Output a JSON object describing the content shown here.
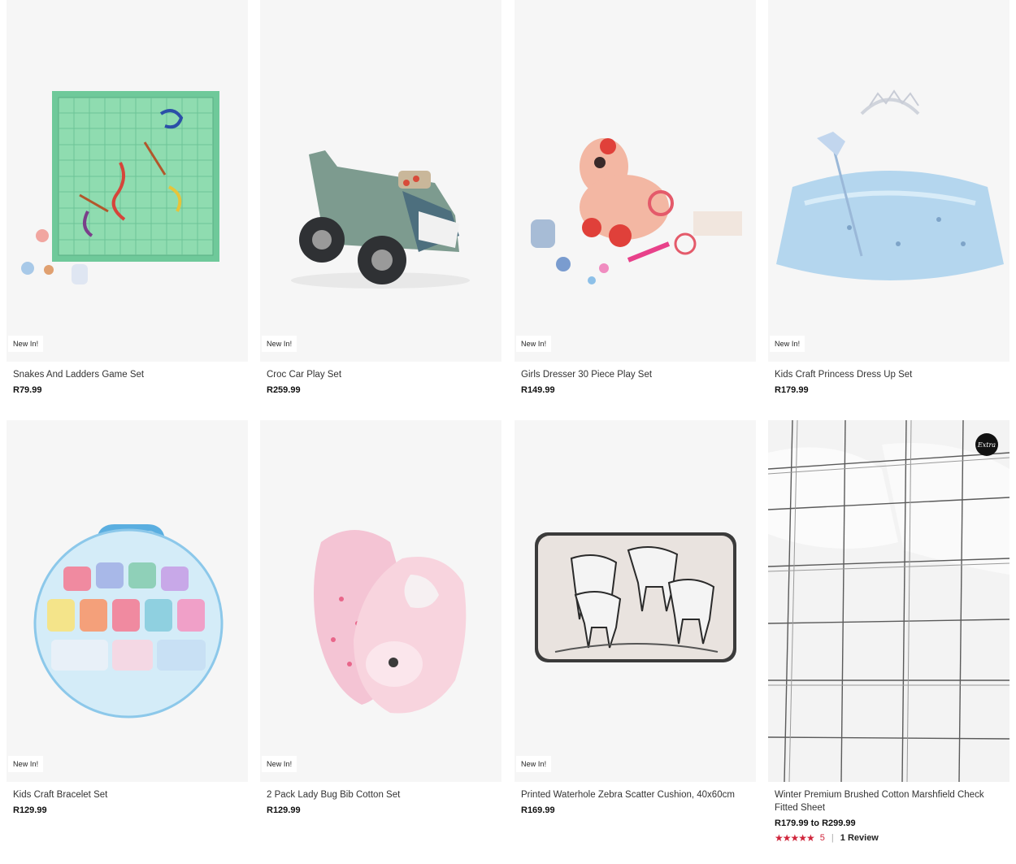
{
  "products": [
    {
      "badge": "New In!",
      "title": "Snakes And Ladders Game Set",
      "price": "R79.99",
      "image": "snakes-and-ladders-board"
    },
    {
      "badge": "New In!",
      "title": "Croc Car Play Set",
      "price": "R259.99",
      "image": "croc-car-toy"
    },
    {
      "badge": "New In!",
      "title": "Girls Dresser 30 Piece Play Set",
      "price": "R149.99",
      "image": "unicorn-dresser-set"
    },
    {
      "badge": "New In!",
      "title": "Kids Craft Princess Dress Up Set",
      "price": "R179.99",
      "image": "tutu-tiara-wand"
    },
    {
      "badge": "New In!",
      "title": "Kids Craft Bracelet Set",
      "price": "R129.99",
      "image": "bead-case"
    },
    {
      "badge": "New In!",
      "title": "2 Pack Lady Bug Bib Cotton Set",
      "price": "R129.99",
      "image": "pink-bibs"
    },
    {
      "badge": "New In!",
      "title": "Printed Waterhole Zebra Scatter Cushion, 40x60cm",
      "price": "R169.99",
      "image": "zebra-cushion"
    },
    {
      "badge": "",
      "title": "Winter Premium Brushed Cotton Marshfield Check Fitted Sheet",
      "price": "R179.99 to R299.99",
      "image": "check-bedding",
      "extra_badge": "Extra",
      "rating": {
        "stars": "★★★★★",
        "value": "5",
        "separator": "|",
        "reviews": "1 Review"
      }
    }
  ],
  "colors": {
    "rating": "#d0263c",
    "image_bg": "#f6f6f6"
  }
}
